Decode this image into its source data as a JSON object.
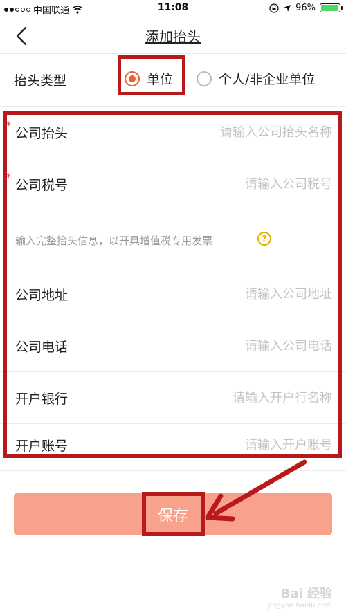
{
  "status": {
    "carrier": "中国联通",
    "time": "11:08",
    "battery": "96%",
    "battery_level": 0.96
  },
  "nav": {
    "title": "添加抬头"
  },
  "invoice_type": {
    "label": "抬头类型",
    "options": [
      {
        "label": "单位",
        "selected": true
      },
      {
        "label": "个人/非企业单位",
        "selected": false
      }
    ]
  },
  "form": {
    "company_title": {
      "label": "公司抬头",
      "placeholder": "请输入公司抬头名称",
      "required": true
    },
    "tax_number": {
      "label": "公司税号",
      "placeholder": "请输入公司税号",
      "required": true
    },
    "hint": "输入完整抬头信息，以开具增值税专用发票",
    "address": {
      "label": "公司地址",
      "placeholder": "请输入公司地址"
    },
    "phone": {
      "label": "公司电话",
      "placeholder": "请输入公司电话"
    },
    "bank": {
      "label": "开户银行",
      "placeholder": "请输入开户行名称"
    },
    "account": {
      "label": "开户账号",
      "placeholder": "请输入开户账号"
    }
  },
  "save_label": "保存",
  "colors": {
    "accent": "#f0602c",
    "save_button": "#f9a28b",
    "annotation": "#b8191a"
  },
  "watermark": {
    "text": "Bai 经验",
    "url": "jingyan.baidu.com"
  }
}
